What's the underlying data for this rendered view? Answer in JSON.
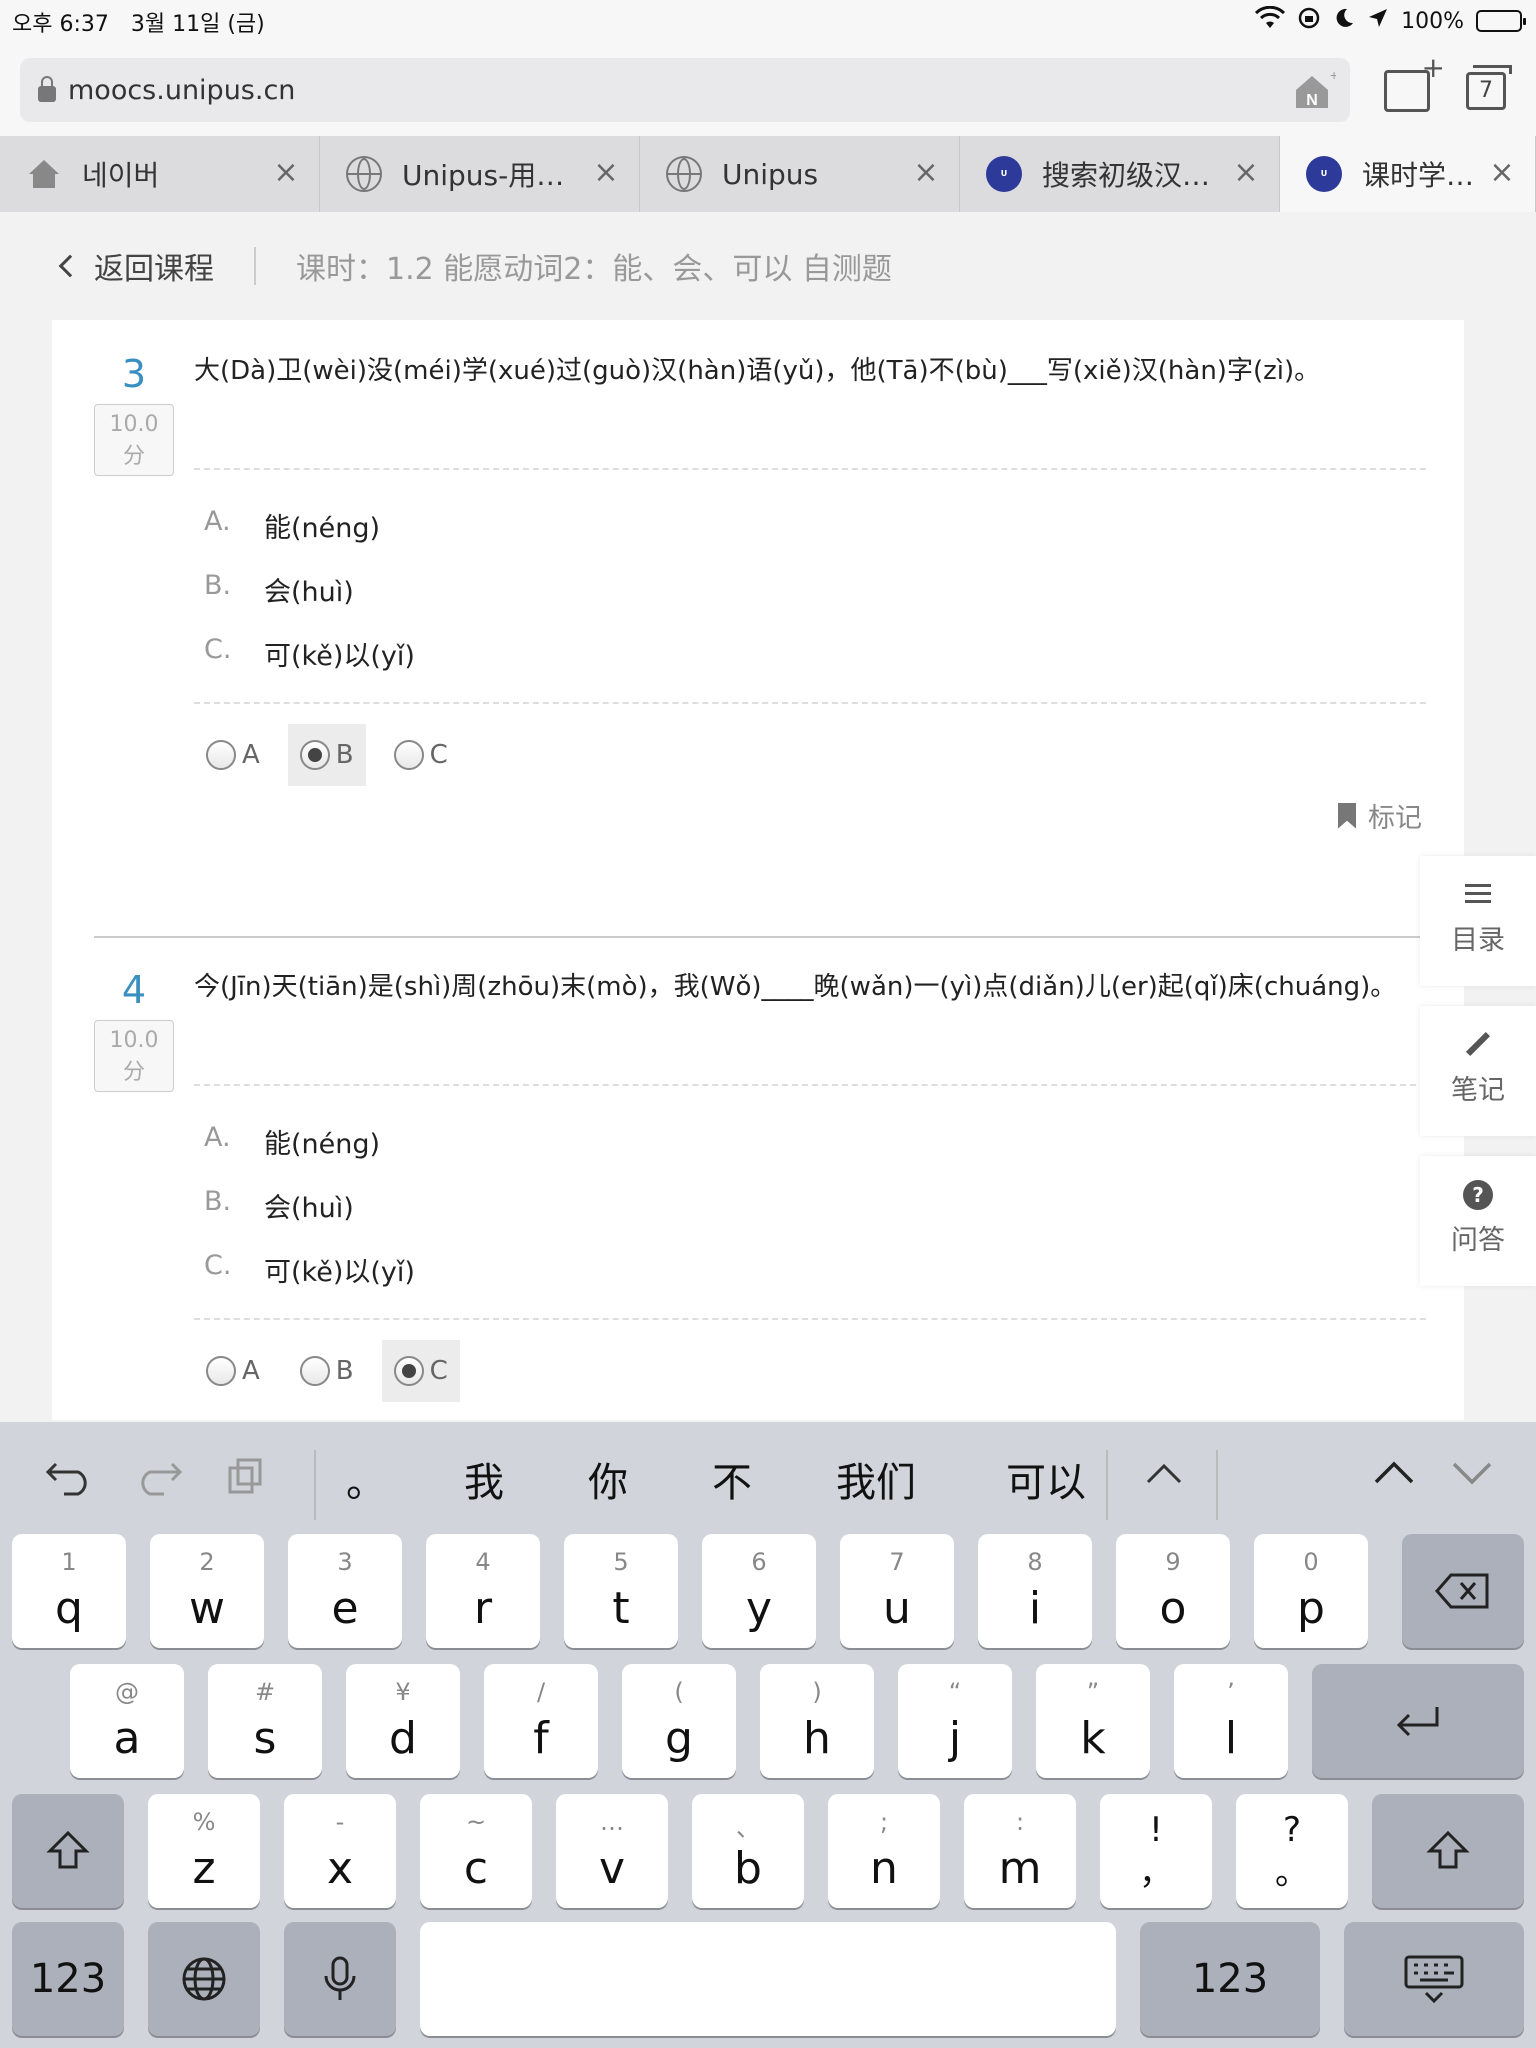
{
  "status": {
    "time": "오후 6:37",
    "date": "3월 11일 (금)",
    "battery": "100%"
  },
  "browser": {
    "url": "moocs.unipus.cn",
    "tab_count": "7",
    "tabs": [
      {
        "label": "네이버",
        "icon": "house-icon"
      },
      {
        "label": "Unipus-用…",
        "icon": "globe-icon"
      },
      {
        "label": "Unipus",
        "icon": "globe-icon"
      },
      {
        "label": "搜索初级汉…",
        "icon": "unipus-logo"
      },
      {
        "label": "课时学习 -…",
        "icon": "unipus-logo"
      }
    ]
  },
  "header": {
    "back_label": "返回课程",
    "lesson_title": "课时：1.2 能愿动词2：能、会、可以 自测题"
  },
  "questions": [
    {
      "number": "3",
      "score_value": "10.0",
      "score_unit": "分",
      "text": "大(Dà)卫(wèi)没(méi)学(xué)过(guò)汉(hàn)语(yǔ)，他(Tā)不(bù)___写(xiě)汉(hàn)字(zì)。",
      "options": [
        {
          "letter": "A.",
          "text": "能(néng)"
        },
        {
          "letter": "B.",
          "text": "会(huì)"
        },
        {
          "letter": "C.",
          "text": "可(kě)以(yǐ)"
        }
      ],
      "choices": [
        "A",
        "B",
        "C"
      ],
      "selected": "B",
      "mark_label": "标记"
    },
    {
      "number": "4",
      "score_value": "10.0",
      "score_unit": "分",
      "text": "今(Jīn)天(tiān)是(shì)周(zhōu)末(mò)，我(Wǒ)____晚(wǎn)一(yì)点(diǎn)儿(er)起(qǐ)床(chuáng)。",
      "options": [
        {
          "letter": "A.",
          "text": "能(néng)"
        },
        {
          "letter": "B.",
          "text": "会(huì)"
        },
        {
          "letter": "C.",
          "text": "可(kě)以(yǐ)"
        }
      ],
      "choices": [
        "A",
        "B",
        "C"
      ],
      "selected": "C"
    }
  ],
  "side_panel": [
    {
      "label": "目录",
      "icon": "menu-icon"
    },
    {
      "label": "笔记",
      "icon": "pencil-icon"
    },
    {
      "label": "问答",
      "icon": "question-icon"
    }
  ],
  "keyboard": {
    "suggestions": [
      "。",
      "我",
      "你",
      "不",
      "我们",
      "可以"
    ],
    "row1": [
      {
        "sub": "1",
        "main": "q"
      },
      {
        "sub": "2",
        "main": "w"
      },
      {
        "sub": "3",
        "main": "e"
      },
      {
        "sub": "4",
        "main": "r"
      },
      {
        "sub": "5",
        "main": "t"
      },
      {
        "sub": "6",
        "main": "y"
      },
      {
        "sub": "7",
        "main": "u"
      },
      {
        "sub": "8",
        "main": "i"
      },
      {
        "sub": "9",
        "main": "o"
      },
      {
        "sub": "0",
        "main": "p"
      }
    ],
    "row2": [
      {
        "sub": "@",
        "main": "a"
      },
      {
        "sub": "#",
        "main": "s"
      },
      {
        "sub": "¥",
        "main": "d"
      },
      {
        "sub": "/",
        "main": "f"
      },
      {
        "sub": "(",
        "main": "g"
      },
      {
        "sub": ")",
        "main": "h"
      },
      {
        "sub": "“",
        "main": "j"
      },
      {
        "sub": "”",
        "main": "k"
      },
      {
        "sub": "’",
        "main": "l"
      }
    ],
    "row3": [
      {
        "sub": "%",
        "main": "z"
      },
      {
        "sub": "-",
        "main": "x"
      },
      {
        "sub": "~",
        "main": "c"
      },
      {
        "sub": "…",
        "main": "v"
      },
      {
        "sub": "、",
        "main": "b"
      },
      {
        "sub": ";",
        "main": "n"
      },
      {
        "sub": ":",
        "main": "m"
      },
      {
        "sub": "!",
        "main": "，"
      },
      {
        "sub": "?",
        "main": "。"
      }
    ],
    "num_label": "123"
  }
}
